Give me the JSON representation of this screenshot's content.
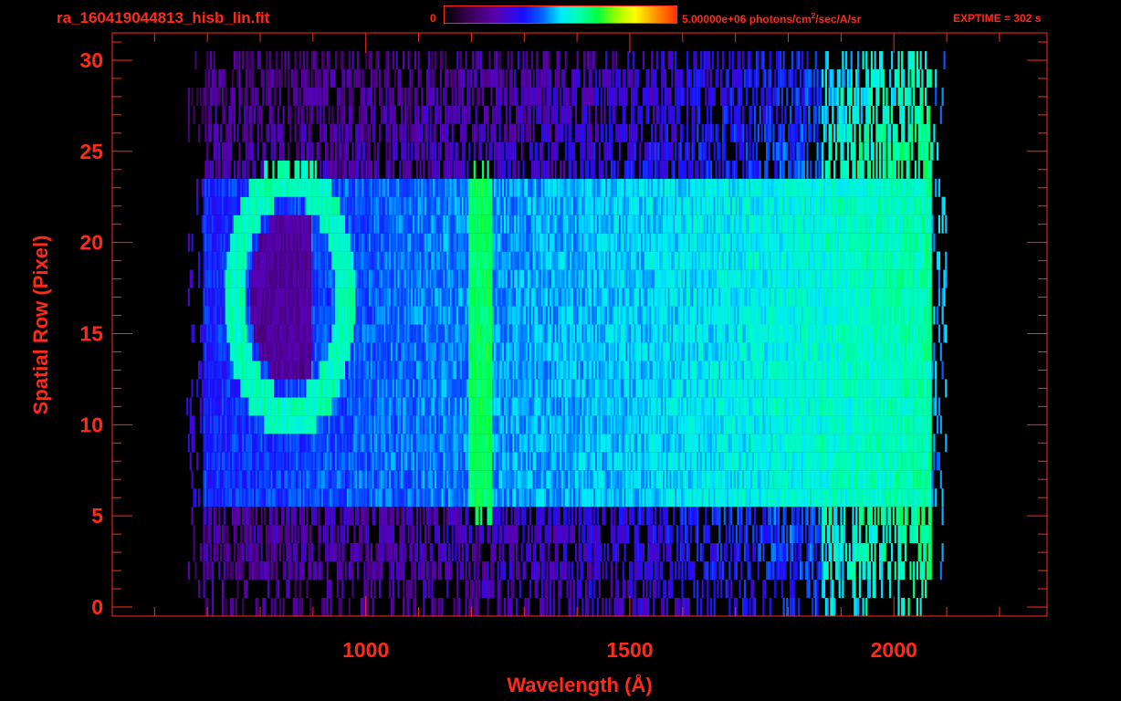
{
  "header": {
    "filename": "ra_160419044813_hisb_lin.fit",
    "colorbar_min_label": "0",
    "colorbar_max_label": "5.00000e+06 photons/cm",
    "colorbar_max_label_sup": "2",
    "colorbar_max_label_tail": "/sec/A/sr",
    "exptime_label": "EXPTIME = 302 s"
  },
  "colors": {
    "axis": "#ff2a1a",
    "background": "#000000"
  },
  "chart_data": {
    "type": "heatmap",
    "title": "ra_160419044813_hisb_lin.fit",
    "xlabel": "Wavelength (Å)",
    "ylabel": "Spatial Row (Pixel)",
    "xlim": [
      520,
      2290
    ],
    "ylim": [
      -0.5,
      31.5
    ],
    "x_ticks": [
      1000,
      1500,
      2000
    ],
    "y_ticks": [
      0,
      5,
      10,
      15,
      20,
      25,
      30
    ],
    "colorbar": {
      "min": 0,
      "max": 5000000,
      "units": "photons/cm^2/sec/A/sr",
      "colormap": "rainbow"
    },
    "grid": false,
    "features": {
      "lyman_alpha_line": {
        "wavelength": 1216,
        "row_range": [
          5,
          24
        ]
      },
      "bright_band_rows": [
        6,
        23
      ],
      "oval_feature": {
        "center_wavelength": 855,
        "center_row": 17,
        "half_width": 105,
        "half_height": 6.5
      },
      "signal_wavelength_range": [
        690,
        2070
      ]
    }
  }
}
